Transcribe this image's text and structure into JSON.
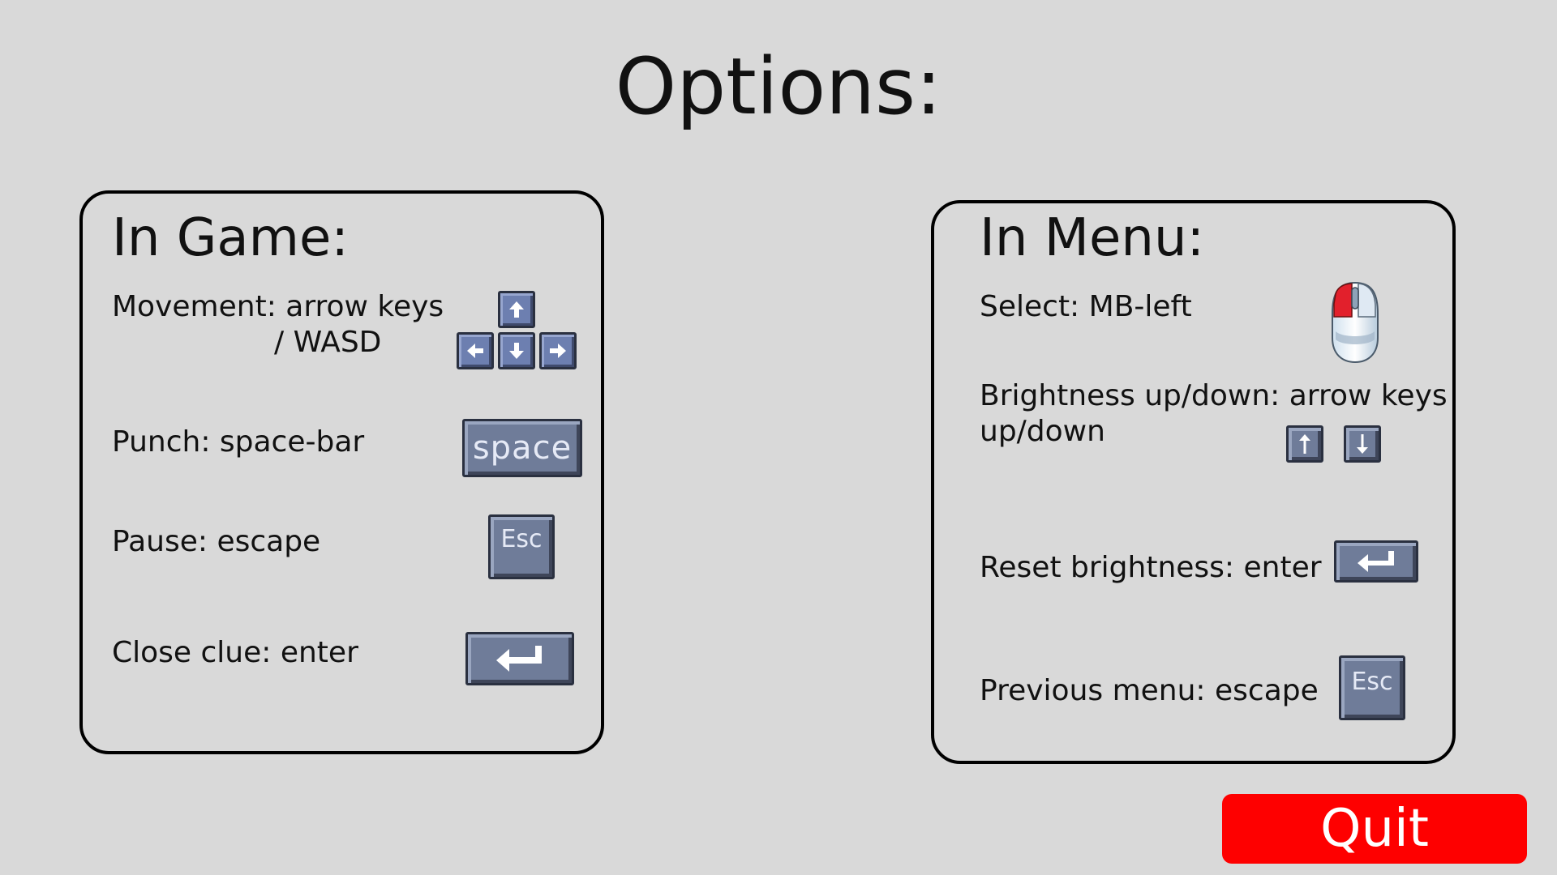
{
  "title": "Options:",
  "in_game": {
    "title": "In Game:",
    "movement_line1": "Movement: arrow keys",
    "movement_line2": "/ WASD",
    "punch": "Punch: space-bar",
    "pause": "Pause: escape",
    "close_clue": "Close clue: enter"
  },
  "in_menu": {
    "title": "In Menu:",
    "select": "Select: MB-left",
    "brightness_line1": "Brightness up/down: arrow keys",
    "brightness_line2": "up/down",
    "reset_brightness": "Reset brightness: enter",
    "previous_menu": "Previous menu: escape"
  },
  "keys": {
    "space": "space",
    "esc": "Esc"
  },
  "icons": {
    "movement": [
      "arrow-up-key-icon",
      "arrow-left-key-icon",
      "arrow-down-key-icon",
      "arrow-right-key-icon"
    ],
    "punch": "space-key-icon",
    "pause": "esc-key-icon",
    "close_clue": "enter-key-icon",
    "select": "mouse-left-button-icon",
    "brightness": [
      "arrow-up-key-icon",
      "arrow-down-key-icon"
    ]
  },
  "quit_label": "Quit",
  "colors": {
    "background": "#d9d9d9",
    "quit_button": "#fe0000",
    "key": "#6d7fb0",
    "mouse_button": "#e2202c"
  }
}
